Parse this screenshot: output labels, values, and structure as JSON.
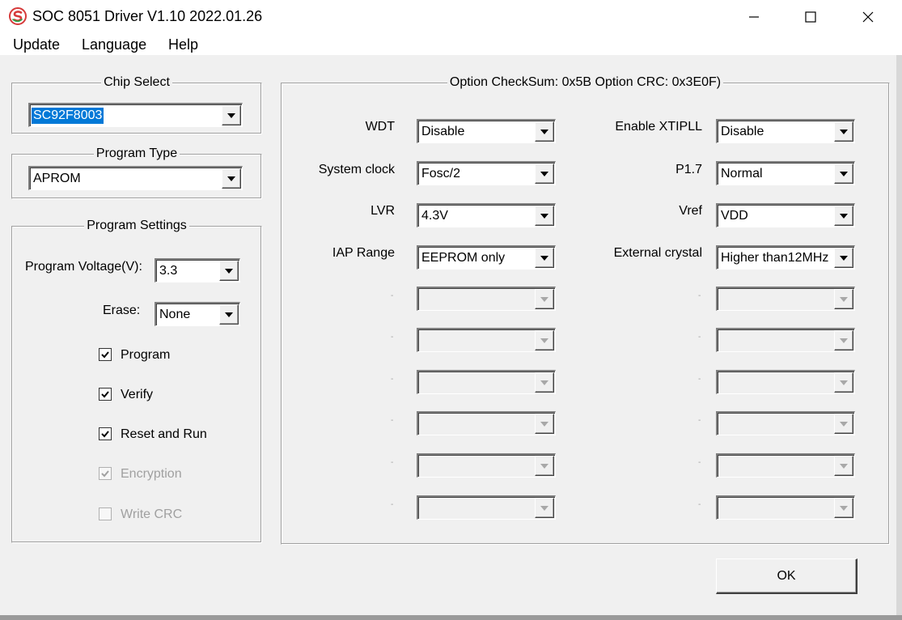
{
  "window": {
    "title": "SOC 8051 Driver V1.10 2022.01.26",
    "controls": [
      "minimize-icon",
      "maximize-icon",
      "close-icon"
    ]
  },
  "menu": {
    "items": [
      "Update",
      "Language",
      "Help"
    ]
  },
  "chip_select": {
    "title": "Chip  Select",
    "value": "SC92F8003"
  },
  "program_type": {
    "title": "Program Type",
    "value": "APROM"
  },
  "program_settings": {
    "title": "Program Settings",
    "voltage_label": "Program Voltage(V):",
    "voltage_value": "3.3",
    "erase_label": "Erase:",
    "erase_value": "None",
    "checkboxes": [
      {
        "label": "Program",
        "checked": true,
        "enabled": true
      },
      {
        "label": "Verify",
        "checked": true,
        "enabled": true
      },
      {
        "label": "Reset and Run",
        "checked": true,
        "enabled": true
      },
      {
        "label": "Encryption",
        "checked": true,
        "enabled": false
      },
      {
        "label": "Write CRC",
        "checked": false,
        "enabled": false
      }
    ]
  },
  "options": {
    "header": "Option CheckSum:  0x5B  Option CRC:  0x3E0F)",
    "left": [
      {
        "label": "WDT",
        "value": "Disable"
      },
      {
        "label": "System clock",
        "value": "Fosc/2"
      },
      {
        "label": "LVR",
        "value": "4.3V"
      },
      {
        "label": "IAP Range",
        "value": "EEPROM only"
      },
      {
        "label": "-",
        "value": ""
      },
      {
        "label": "-",
        "value": ""
      },
      {
        "label": "-",
        "value": ""
      },
      {
        "label": "-",
        "value": ""
      },
      {
        "label": "-",
        "value": ""
      },
      {
        "label": "-",
        "value": ""
      }
    ],
    "right": [
      {
        "label": "Enable XTIPLL",
        "value": "Disable"
      },
      {
        "label": "P1.7",
        "value": "Normal"
      },
      {
        "label": "Vref",
        "value": "VDD"
      },
      {
        "label": "External crystal",
        "value": "Higher than12MHz"
      },
      {
        "label": "-",
        "value": ""
      },
      {
        "label": "-",
        "value": ""
      },
      {
        "label": "-",
        "value": ""
      },
      {
        "label": "-",
        "value": ""
      },
      {
        "label": "-",
        "value": ""
      },
      {
        "label": "-",
        "value": ""
      }
    ]
  },
  "ok_button": {
    "label": "OK"
  },
  "colors": {
    "selection": "#0078d7",
    "window_bg": "#f0f0f0",
    "app_icon": "#d63a3a"
  }
}
